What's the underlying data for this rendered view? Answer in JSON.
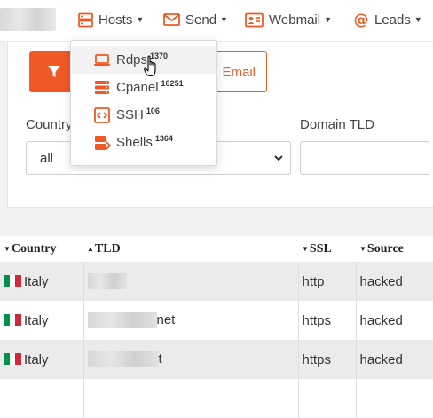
{
  "nav": {
    "hosts": "Hosts",
    "send": "Send",
    "webmail": "Webmail",
    "leads": "Leads"
  },
  "colors": {
    "accent": "#ef5a24"
  },
  "filter": {
    "email_label": "Email",
    "country_label": "Country",
    "country_value": "all",
    "domain_tld_label": "Domain TLD",
    "domain_tld_value": ""
  },
  "hosts_menu": [
    {
      "label": "Rdps",
      "count": "1370",
      "icon": "laptop-icon"
    },
    {
      "label": "Cpanel",
      "count": "10251",
      "icon": "server-icon"
    },
    {
      "label": "SSH",
      "count": "106",
      "icon": "code-icon"
    },
    {
      "label": "Shells",
      "count": "1364",
      "icon": "shell-icon"
    }
  ],
  "table": {
    "headers": {
      "country": "Country",
      "tld": "TLD",
      "ssl": "SSL",
      "source": "Source"
    },
    "rows": [
      {
        "country": "Italy",
        "tld": "",
        "ssl": "http",
        "source": "hacked"
      },
      {
        "country": "Italy",
        "tld": "net",
        "ssl": "https",
        "source": "hacked"
      },
      {
        "country": "Italy",
        "tld": "t",
        "ssl": "https",
        "source": "hacked"
      }
    ]
  }
}
